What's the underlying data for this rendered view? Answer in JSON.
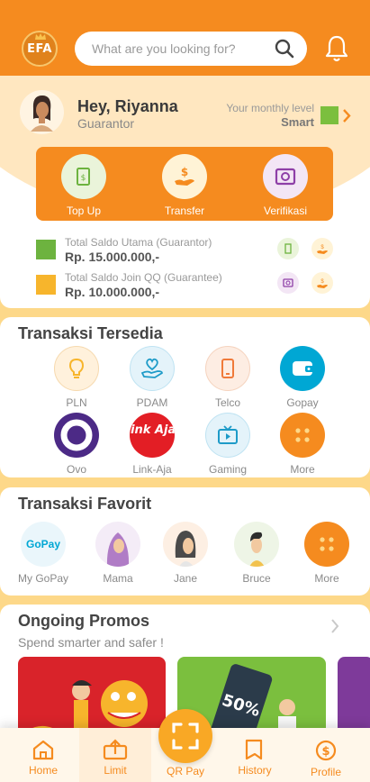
{
  "header": {
    "logo_text": "EFA",
    "search_placeholder": "What are you looking for?"
  },
  "profile": {
    "greeting": "Hey, Riyanna",
    "role": "Guarantor",
    "level_label": "Your monthly level",
    "level_value": "Smart",
    "level_color": "#7BBF3E"
  },
  "actions": [
    {
      "label": "Top Up",
      "icon": "wallet-icon"
    },
    {
      "label": "Transfer",
      "icon": "hand-money-icon"
    },
    {
      "label": "Verifikasi",
      "icon": "safe-icon"
    }
  ],
  "balances": [
    {
      "title": "Total Saldo Utama (Guarantor)",
      "value": "Rp. 15.000.000,-",
      "color": "#6DB33F"
    },
    {
      "title": "Total Saldo Join QQ (Guarantee)",
      "value": "Rp. 10.000.000,-",
      "color": "#F7B52C"
    }
  ],
  "transaksi": {
    "title": "Transaksi Tersedia",
    "items": [
      {
        "label": "PLN",
        "icon": "bulb-icon"
      },
      {
        "label": "PDAM",
        "icon": "water-heart-icon"
      },
      {
        "label": "Telco",
        "icon": "phone-icon"
      },
      {
        "label": "Gopay",
        "icon": "gopay-wallet-icon"
      },
      {
        "label": "Ovo",
        "icon": "ovo-logo-icon"
      },
      {
        "label": "Link-Aja",
        "icon": "linkaja-logo-icon",
        "logo_text": "Link Aja!"
      },
      {
        "label": "Gaming",
        "icon": "tv-icon"
      },
      {
        "label": "More",
        "icon": "more-dots-icon"
      }
    ]
  },
  "favorit": {
    "title": "Transaksi Favorit",
    "items": [
      {
        "label": "My GoPay",
        "logo_text": "GoPay"
      },
      {
        "label": "Mama"
      },
      {
        "label": "Jane"
      },
      {
        "label": "Bruce"
      },
      {
        "label": "More"
      }
    ]
  },
  "promos": {
    "title": "Ongoing Promos",
    "subtitle": "Spend smarter and safer !"
  },
  "nav": {
    "items": [
      "Home",
      "Limit",
      "QR Pay",
      "History",
      "Profile"
    ]
  },
  "colors": {
    "primary": "#F58B1F",
    "background": "#FDD889"
  }
}
